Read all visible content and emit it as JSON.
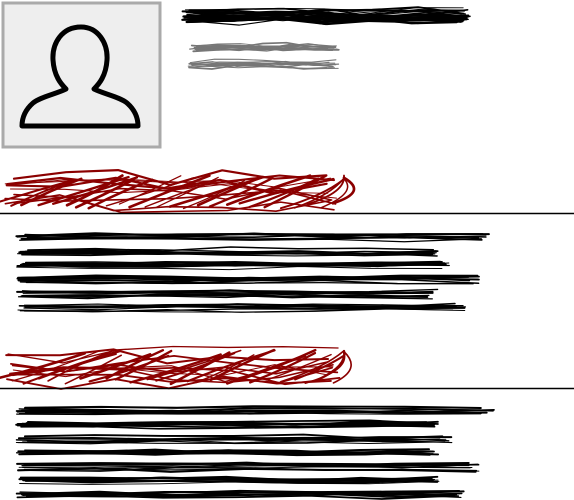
{
  "profile": {
    "avatar_icon": "user-silhouette-icon",
    "name": "",
    "subtitle_lines": [
      "",
      ""
    ]
  },
  "sections": [
    {
      "heading": "",
      "line_count": 6
    },
    {
      "heading": "",
      "line_count": 7
    }
  ],
  "colors": {
    "background": "#ffffff",
    "ink": "#000000",
    "secondary_ink": "#777777",
    "heading_accent": "#8b0000",
    "photo_frame_fill": "#eeeeee",
    "photo_frame_border": "#aaaaaa",
    "divider": "#000000"
  }
}
